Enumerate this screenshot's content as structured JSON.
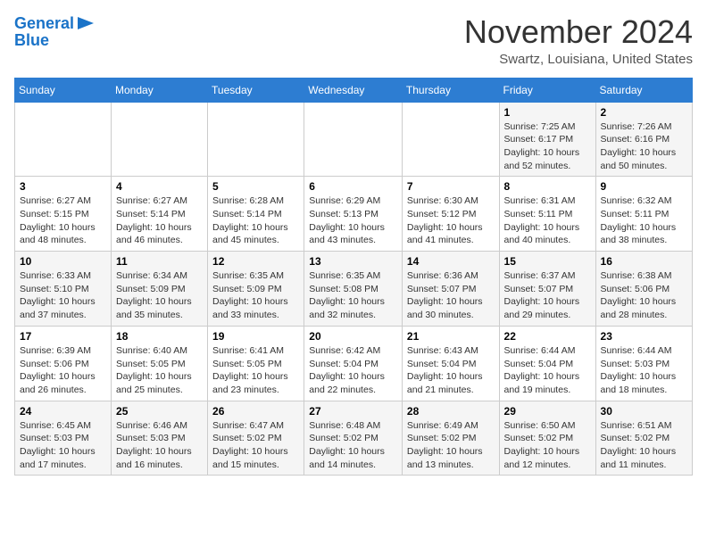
{
  "header": {
    "logo_line1": "General",
    "logo_line2": "Blue",
    "month": "November 2024",
    "location": "Swartz, Louisiana, United States"
  },
  "weekdays": [
    "Sunday",
    "Monday",
    "Tuesday",
    "Wednesday",
    "Thursday",
    "Friday",
    "Saturday"
  ],
  "weeks": [
    [
      {
        "day": "",
        "info": ""
      },
      {
        "day": "",
        "info": ""
      },
      {
        "day": "",
        "info": ""
      },
      {
        "day": "",
        "info": ""
      },
      {
        "day": "",
        "info": ""
      },
      {
        "day": "1",
        "info": "Sunrise: 7:25 AM\nSunset: 6:17 PM\nDaylight: 10 hours\nand 52 minutes."
      },
      {
        "day": "2",
        "info": "Sunrise: 7:26 AM\nSunset: 6:16 PM\nDaylight: 10 hours\nand 50 minutes."
      }
    ],
    [
      {
        "day": "3",
        "info": "Sunrise: 6:27 AM\nSunset: 5:15 PM\nDaylight: 10 hours\nand 48 minutes."
      },
      {
        "day": "4",
        "info": "Sunrise: 6:27 AM\nSunset: 5:14 PM\nDaylight: 10 hours\nand 46 minutes."
      },
      {
        "day": "5",
        "info": "Sunrise: 6:28 AM\nSunset: 5:14 PM\nDaylight: 10 hours\nand 45 minutes."
      },
      {
        "day": "6",
        "info": "Sunrise: 6:29 AM\nSunset: 5:13 PM\nDaylight: 10 hours\nand 43 minutes."
      },
      {
        "day": "7",
        "info": "Sunrise: 6:30 AM\nSunset: 5:12 PM\nDaylight: 10 hours\nand 41 minutes."
      },
      {
        "day": "8",
        "info": "Sunrise: 6:31 AM\nSunset: 5:11 PM\nDaylight: 10 hours\nand 40 minutes."
      },
      {
        "day": "9",
        "info": "Sunrise: 6:32 AM\nSunset: 5:11 PM\nDaylight: 10 hours\nand 38 minutes."
      }
    ],
    [
      {
        "day": "10",
        "info": "Sunrise: 6:33 AM\nSunset: 5:10 PM\nDaylight: 10 hours\nand 37 minutes."
      },
      {
        "day": "11",
        "info": "Sunrise: 6:34 AM\nSunset: 5:09 PM\nDaylight: 10 hours\nand 35 minutes."
      },
      {
        "day": "12",
        "info": "Sunrise: 6:35 AM\nSunset: 5:09 PM\nDaylight: 10 hours\nand 33 minutes."
      },
      {
        "day": "13",
        "info": "Sunrise: 6:35 AM\nSunset: 5:08 PM\nDaylight: 10 hours\nand 32 minutes."
      },
      {
        "day": "14",
        "info": "Sunrise: 6:36 AM\nSunset: 5:07 PM\nDaylight: 10 hours\nand 30 minutes."
      },
      {
        "day": "15",
        "info": "Sunrise: 6:37 AM\nSunset: 5:07 PM\nDaylight: 10 hours\nand 29 minutes."
      },
      {
        "day": "16",
        "info": "Sunrise: 6:38 AM\nSunset: 5:06 PM\nDaylight: 10 hours\nand 28 minutes."
      }
    ],
    [
      {
        "day": "17",
        "info": "Sunrise: 6:39 AM\nSunset: 5:06 PM\nDaylight: 10 hours\nand 26 minutes."
      },
      {
        "day": "18",
        "info": "Sunrise: 6:40 AM\nSunset: 5:05 PM\nDaylight: 10 hours\nand 25 minutes."
      },
      {
        "day": "19",
        "info": "Sunrise: 6:41 AM\nSunset: 5:05 PM\nDaylight: 10 hours\nand 23 minutes."
      },
      {
        "day": "20",
        "info": "Sunrise: 6:42 AM\nSunset: 5:04 PM\nDaylight: 10 hours\nand 22 minutes."
      },
      {
        "day": "21",
        "info": "Sunrise: 6:43 AM\nSunset: 5:04 PM\nDaylight: 10 hours\nand 21 minutes."
      },
      {
        "day": "22",
        "info": "Sunrise: 6:44 AM\nSunset: 5:04 PM\nDaylight: 10 hours\nand 19 minutes."
      },
      {
        "day": "23",
        "info": "Sunrise: 6:44 AM\nSunset: 5:03 PM\nDaylight: 10 hours\nand 18 minutes."
      }
    ],
    [
      {
        "day": "24",
        "info": "Sunrise: 6:45 AM\nSunset: 5:03 PM\nDaylight: 10 hours\nand 17 minutes."
      },
      {
        "day": "25",
        "info": "Sunrise: 6:46 AM\nSunset: 5:03 PM\nDaylight: 10 hours\nand 16 minutes."
      },
      {
        "day": "26",
        "info": "Sunrise: 6:47 AM\nSunset: 5:02 PM\nDaylight: 10 hours\nand 15 minutes."
      },
      {
        "day": "27",
        "info": "Sunrise: 6:48 AM\nSunset: 5:02 PM\nDaylight: 10 hours\nand 14 minutes."
      },
      {
        "day": "28",
        "info": "Sunrise: 6:49 AM\nSunset: 5:02 PM\nDaylight: 10 hours\nand 13 minutes."
      },
      {
        "day": "29",
        "info": "Sunrise: 6:50 AM\nSunset: 5:02 PM\nDaylight: 10 hours\nand 12 minutes."
      },
      {
        "day": "30",
        "info": "Sunrise: 6:51 AM\nSunset: 5:02 PM\nDaylight: 10 hours\nand 11 minutes."
      }
    ]
  ]
}
